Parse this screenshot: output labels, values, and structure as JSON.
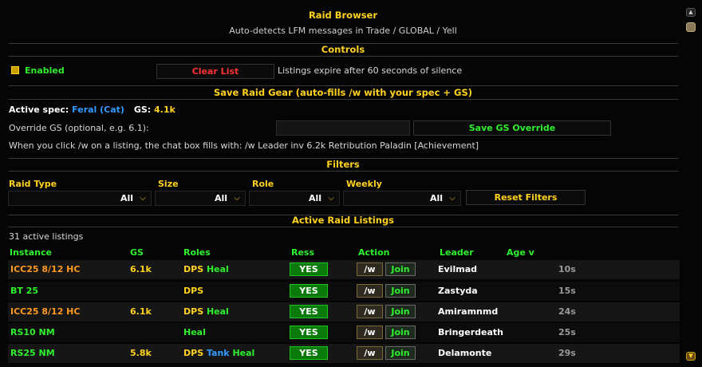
{
  "header": {
    "title": "Raid Browser",
    "subtitle": "Auto-detects LFM messages in Trade / GLOBAL / Yell"
  },
  "controls": {
    "title": "Controls",
    "enabled_label": "Enabled",
    "clear_label": "Clear List",
    "expire_note": "Listings expire after 60 seconds of silence"
  },
  "gear": {
    "title": "Save Raid Gear  (auto-fills /w with your spec + GS)",
    "spec_label": "Active spec:",
    "spec_value": "Feral (Cat)",
    "gs_label": "GS:",
    "gs_value": "4.1k",
    "override_label": "Override GS (optional, e.g. 6.1):",
    "override_value": "",
    "save_label": "Save GS Override",
    "hint": "When you click /w on a listing, the chat box fills with:  /w Leader inv 6.2k Retribution Paladin [Achievement]"
  },
  "filters": {
    "title": "Filters",
    "raid_type": {
      "label": "Raid Type",
      "value": "All"
    },
    "size": {
      "label": "Size",
      "value": "All"
    },
    "role": {
      "label": "Role",
      "value": "All"
    },
    "weekly": {
      "label": "Weekly",
      "value": "All"
    },
    "reset_label": "Reset Filters"
  },
  "listings": {
    "title": "Active Raid Listings",
    "count_text": "31 active listings",
    "columns": {
      "instance": "Instance",
      "gs": "GS",
      "roles": "Roles",
      "ress": "Ress",
      "action": "Action",
      "leader": "Leader",
      "age": "Age  v"
    },
    "action_w": "/w",
    "action_join": "Join",
    "rows": [
      {
        "instance": "ICC25 8/12 HC",
        "gs": "6.1k",
        "dps": "DPS",
        "tank": "",
        "heal": "Heal",
        "ress": "YES",
        "leader": "Evilmad",
        "age": "10s"
      },
      {
        "instance": "BT 25",
        "gs": "",
        "dps": "DPS",
        "tank": "",
        "heal": "",
        "ress": "YES",
        "leader": "Zastyda",
        "age": "15s"
      },
      {
        "instance": "ICC25 8/12 HC",
        "gs": "6.1k",
        "dps": "DPS",
        "tank": "",
        "heal": "Heal",
        "ress": "YES",
        "leader": "Amiramnmd",
        "age": "24s"
      },
      {
        "instance": "RS10 NM",
        "gs": "",
        "dps": "",
        "tank": "",
        "heal": "Heal",
        "ress": "YES",
        "leader": "Bringerdeath",
        "age": "25s"
      },
      {
        "instance": "RS25 NM",
        "gs": "5.8k",
        "dps": "DPS",
        "tank": "Tank",
        "heal": "Heal",
        "ress": "YES",
        "leader": "Delamonte",
        "age": "29s"
      }
    ]
  },
  "colors": {
    "accent_gold": "#ffd21f",
    "green": "#2ef02e",
    "orange": "#ff9a1f",
    "red": "#ff3333",
    "blue": "#3399ff"
  }
}
